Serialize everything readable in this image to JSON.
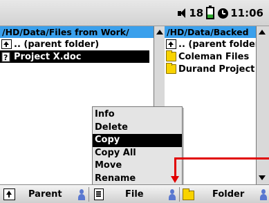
{
  "status_bar": {
    "volume_icon": "speaker-icon",
    "volume": "18",
    "battery_icon": "battery-icon",
    "clock_icon": "clock-icon",
    "time": "11:06"
  },
  "left_panel": {
    "path": "/HD/Data/Files from Work/",
    "items": [
      {
        "label": ".. (parent folder)",
        "icon": "parent-folder-icon",
        "selected": false
      },
      {
        "label": "Project X.doc",
        "icon": "unknown-file-icon",
        "selected": true
      }
    ]
  },
  "right_panel": {
    "path": "/HD/Data/Backed",
    "items": [
      {
        "label": ".. (parent folder",
        "icon": "parent-folder-icon"
      },
      {
        "label": "Coleman Files",
        "icon": "folder-icon"
      },
      {
        "label": "Durand Project",
        "icon": "folder-icon"
      }
    ]
  },
  "context_menu": {
    "items": [
      "Info",
      "Delete",
      "Copy",
      "Copy All",
      "Move",
      "Rename"
    ],
    "selected": "Copy"
  },
  "toolbar": {
    "parent_label": "Parent",
    "file_label": "File",
    "folder_label": "Folder"
  },
  "colors": {
    "path_bar": "#3aa0ec",
    "selection": "#000000",
    "folder": "#f8d300",
    "annotation_arrow": "#e10000"
  }
}
